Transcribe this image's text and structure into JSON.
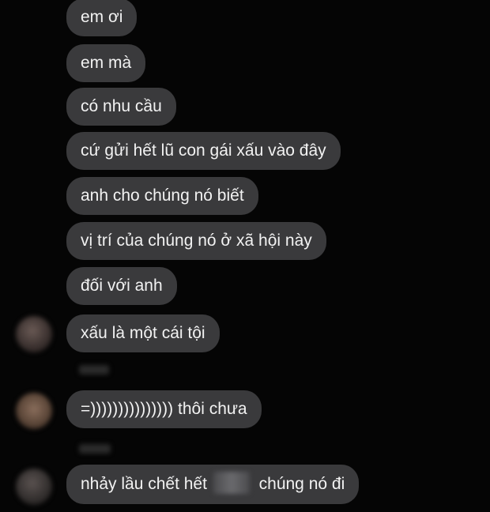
{
  "messages": [
    "em ơi",
    "em mà",
    "có nhu cầu",
    "cứ gửi hết lũ con gái xấu vào đây",
    "anh cho chúng nó biết",
    "vị trí của chúng nó ở xã hội này",
    "đối với anh",
    "xấu là một cái tội",
    "=))))))))))))))) thôi chưa",
    "nhảy lầu chết hết",
    "chúng nó đi"
  ]
}
